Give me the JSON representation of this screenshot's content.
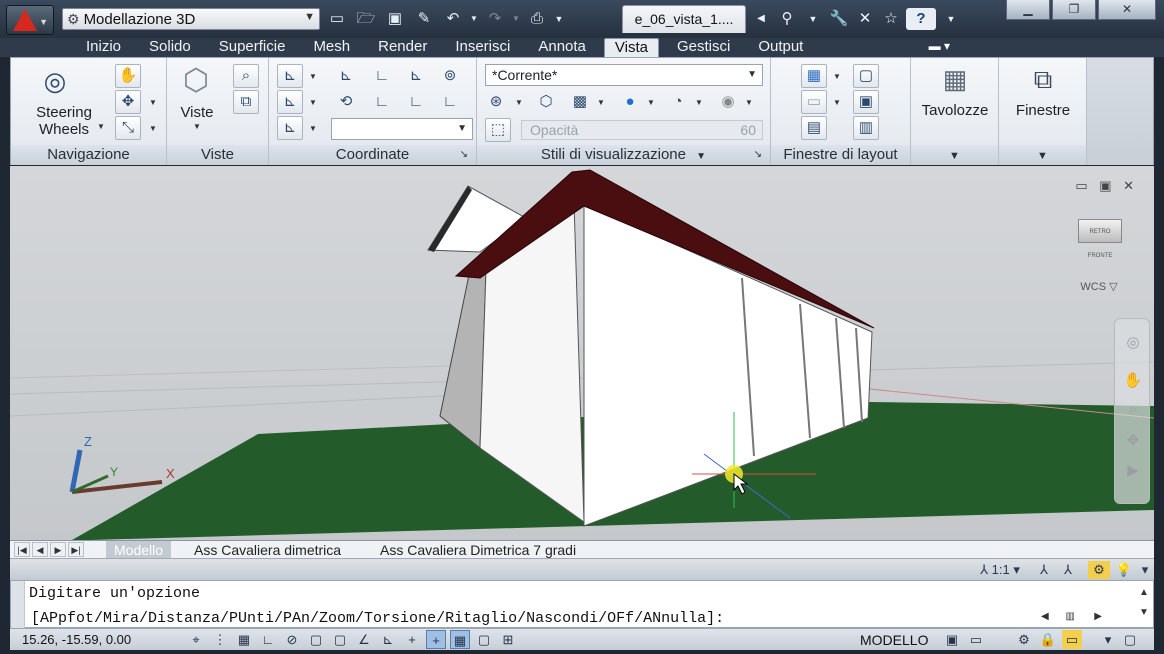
{
  "app": {
    "workspace": "Modellazione 3D",
    "document_tab": "e_06_vista_1....",
    "logo_color": "#d7281f"
  },
  "ribbon_tabs": [
    "Inizio",
    "Solido",
    "Superficie",
    "Mesh",
    "Render",
    "Inserisci",
    "Annota",
    "Vista",
    "Gestisci",
    "Output"
  ],
  "active_tab": "Vista",
  "panels": {
    "navigazione": {
      "title": "Navigazione",
      "steering_line1": "Steering",
      "steering_line2": "Wheels"
    },
    "viste": {
      "title": "Viste",
      "label": "Viste"
    },
    "coordinate": {
      "title": "Coordinate"
    },
    "stili": {
      "title": "Stili di visualizzazione",
      "visual_style": "*Corrente*",
      "opacity_label": "Opacità",
      "opacity_value": "60"
    },
    "finestre_layout": {
      "title": "Finestre di layout"
    },
    "tavolozze": {
      "label": "Tavolozze"
    },
    "finestre": {
      "label": "Finestre"
    }
  },
  "viewport": {
    "wcs": "WCS",
    "viewcube_left": "RETRO",
    "viewcube_right": "FRONTE",
    "axis_x": "X",
    "axis_y": "Y",
    "axis_z": "Z",
    "ground_color": "#235c2a",
    "roof_color": "#4a0d10"
  },
  "layout_tabs": {
    "model": "Modello",
    "tab1": "Ass Cavaliera dimetrica",
    "tab2": "Ass Cavaliera Dimetrica 7 gradi"
  },
  "annotation_scale": "1:1",
  "command": {
    "prompt": "Digitare un'opzione",
    "options": "[APpfot/Mira/Distanza/PUnti/PAn/Zoom/Torsione/Ritaglio/Nascondi/OFf/ANnulla]:"
  },
  "status": {
    "coords": "15.26, -15.59, 0.00",
    "space": "MODELLO"
  }
}
